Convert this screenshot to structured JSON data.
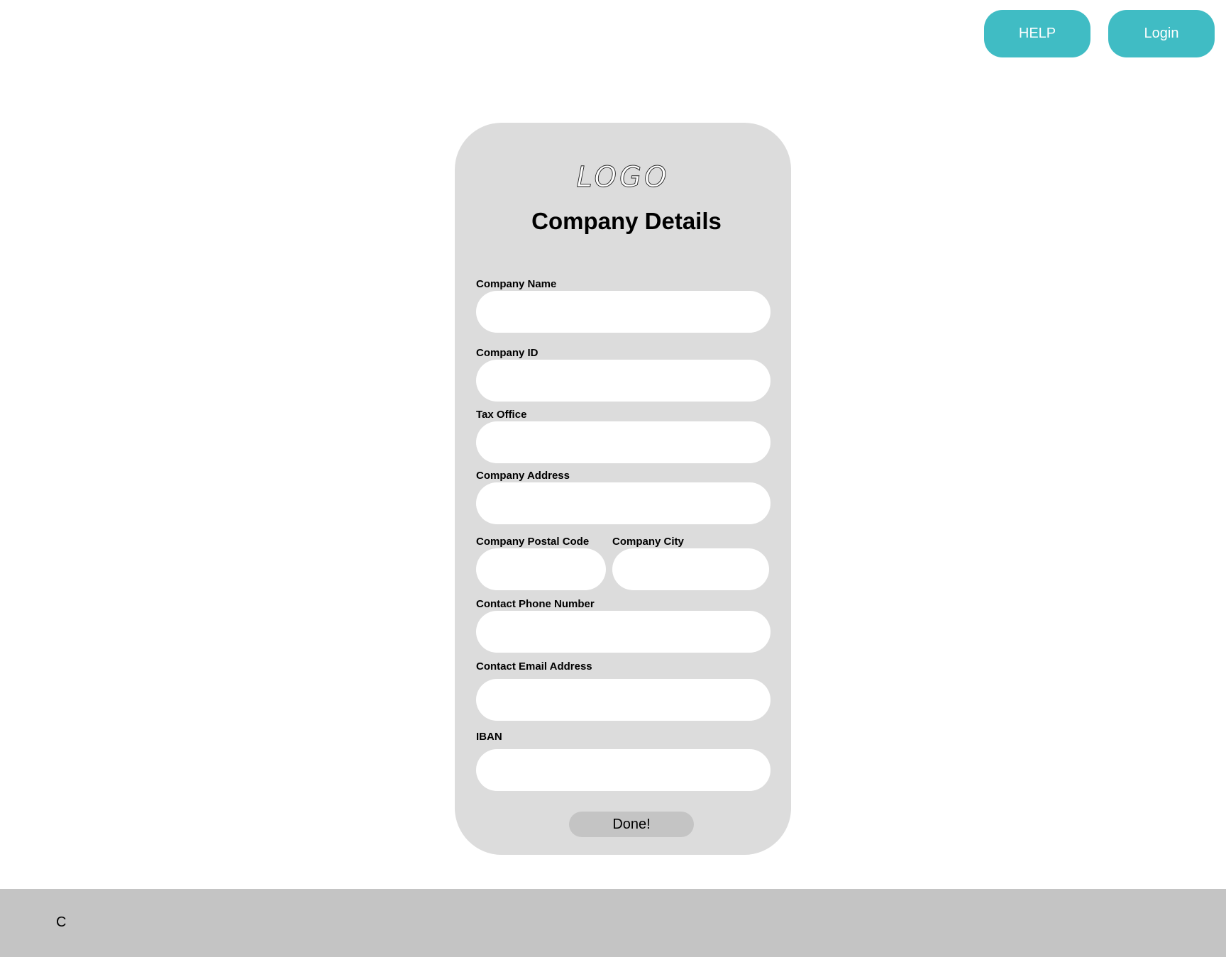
{
  "header": {
    "help_label": "HELP",
    "login_label": "Login"
  },
  "card": {
    "logo_text": "LOGO",
    "title": "Company Details",
    "fields": {
      "company_name": {
        "label": "Company Name",
        "value": "",
        "placeholder": ""
      },
      "company_id": {
        "label": "Company ID",
        "value": "",
        "placeholder": ""
      },
      "tax_office": {
        "label": "Tax Office",
        "value": "",
        "placeholder": ""
      },
      "company_address": {
        "label": "Company Address",
        "value": "",
        "placeholder": ""
      },
      "postal_code": {
        "label": "Company Postal Code",
        "value": "",
        "placeholder": ""
      },
      "city": {
        "label": "Company City",
        "value": "",
        "placeholder": ""
      },
      "phone": {
        "label": "Contact Phone Number",
        "value": "",
        "placeholder": ""
      },
      "email": {
        "label": "Contact Email Address",
        "value": "",
        "placeholder": ""
      },
      "iban": {
        "label": "IBAN",
        "value": "",
        "placeholder": ""
      }
    },
    "done_label": "Done!"
  },
  "footer": {
    "text": "C"
  },
  "colors": {
    "accent": "#40bcc4",
    "card_background": "#dcdcdc",
    "footer_background": "#c4c4c4",
    "done_button": "#c4c4c4",
    "field_background": "#ffffff"
  }
}
